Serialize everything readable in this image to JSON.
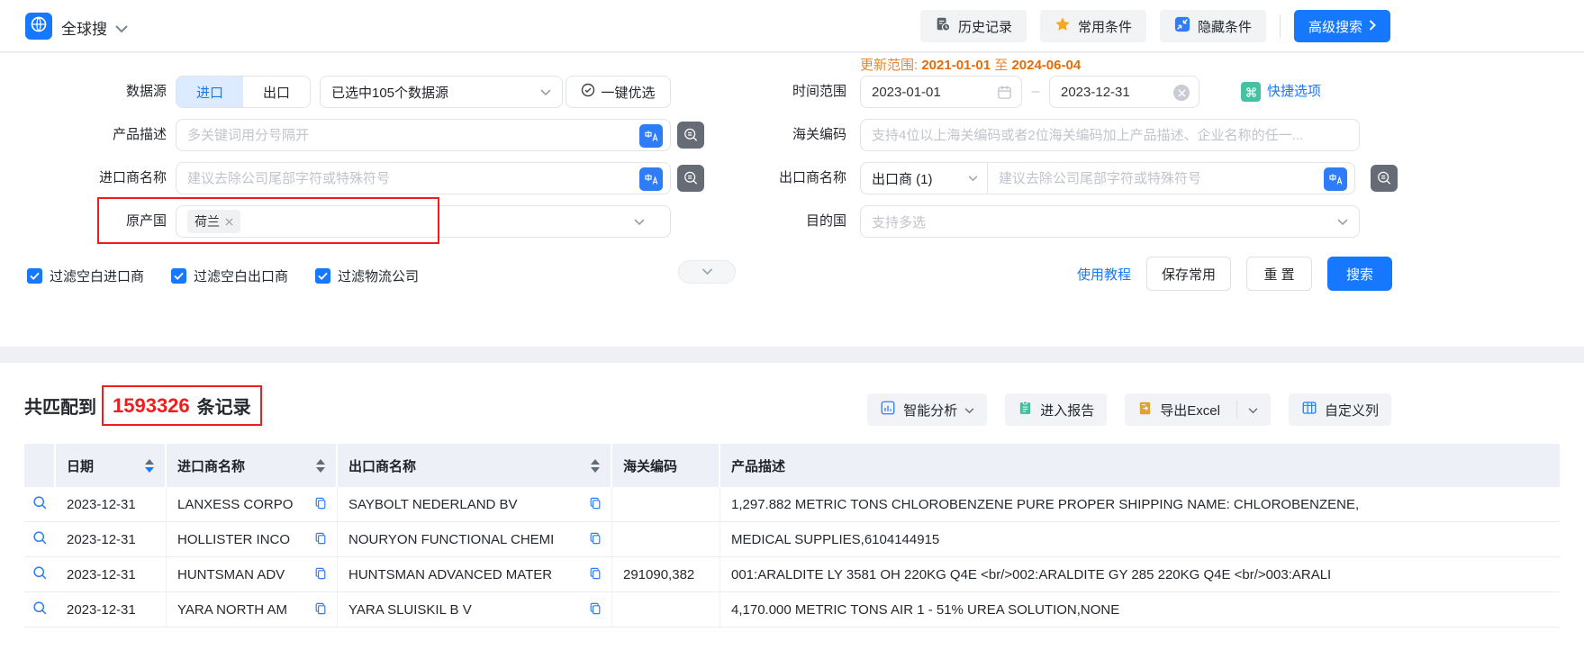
{
  "topbar": {
    "title": "全球搜",
    "history": "历史记录",
    "favorites": "常用条件",
    "hide_conditions": "隐藏条件",
    "advanced_search": "高级搜索"
  },
  "update_range": {
    "label": "更新范围:",
    "from": "2021-01-01",
    "to_word": "至",
    "to": "2024-06-04"
  },
  "form": {
    "data_source": {
      "label": "数据源",
      "import_tab": "进口",
      "export_tab": "出口",
      "selected": "已选中105个数据源",
      "optimize": "一键优选"
    },
    "time_range": {
      "label": "时间范围",
      "start": "2023-01-01",
      "dash": "–",
      "end": "2023-12-31",
      "quick": "快捷选项"
    },
    "product_desc": {
      "label": "产品描述",
      "placeholder": "多关键词用分号隔开"
    },
    "hs_code": {
      "label": "海关编码",
      "placeholder": "支持4位以上海关编码或者2位海关编码加上产品描述、企业名称的任一..."
    },
    "importer": {
      "label": "进口商名称",
      "placeholder": "建议去除公司尾部字符或特殊符号"
    },
    "exporter": {
      "label": "出口商名称",
      "type_selected": "出口商 (1)",
      "placeholder": "建议去除公司尾部字符或特殊符号"
    },
    "origin": {
      "label": "原产国",
      "tag": "荷兰"
    },
    "destination": {
      "label": "目的国",
      "placeholder": "支持多选"
    },
    "filters": [
      {
        "label": "过滤空白进口商",
        "checked": true
      },
      {
        "label": "过滤空白出口商",
        "checked": true
      },
      {
        "label": "过滤物流公司",
        "checked": true
      }
    ],
    "actions": {
      "tutorial": "使用教程",
      "save": "保存常用",
      "reset": "重 置",
      "search": "搜索"
    }
  },
  "results": {
    "prefix": "共匹配到",
    "count": "1593326",
    "suffix": "条记录",
    "toolbar": {
      "analysis": "智能分析",
      "report": "进入报告",
      "export": "导出Excel",
      "columns": "自定义列"
    }
  },
  "table": {
    "headers": {
      "date": "日期",
      "importer": "进口商名称",
      "exporter": "出口商名称",
      "hs_code": "海关编码",
      "product": "产品描述"
    },
    "sort": {
      "date": "desc"
    },
    "rows": [
      {
        "date": "2023-12-31",
        "importer": "LANXESS CORPO",
        "exporter": "SAYBOLT NEDERLAND BV",
        "hs_code": "",
        "product": "1,297.882 METRIC TONS CHLOROBENZENE PURE PROPER SHIPPING NAME: CHLOROBENZENE,"
      },
      {
        "date": "2023-12-31",
        "importer": "HOLLISTER INCO",
        "exporter": "NOURYON FUNCTIONAL CHEMI",
        "hs_code": "",
        "product": "MEDICAL SUPPLIES,6104144915"
      },
      {
        "date": "2023-12-31",
        "importer": "HUNTSMAN ADV",
        "exporter": "HUNTSMAN ADVANCED MATER",
        "hs_code": "291090,382",
        "product": "001:ARALDITE LY 3581 OH 220KG Q4E <br/>002:ARALDITE GY 285 220KG Q4E <br/>003:ARALI"
      },
      {
        "date": "2023-12-31",
        "importer": "YARA NORTH AM",
        "exporter": "YARA SLUISKIL B V",
        "hs_code": "",
        "product": "4,170.000 METRIC TONS AIR 1 - 51% UREA SOLUTION,NONE"
      }
    ]
  },
  "colors": {
    "primary": "#1677ff",
    "update_orange": "#e56c0a",
    "annotation_red": "#f21c1c",
    "star_gold": "#f5a623",
    "shortcut_teal": "#43c3a2"
  }
}
